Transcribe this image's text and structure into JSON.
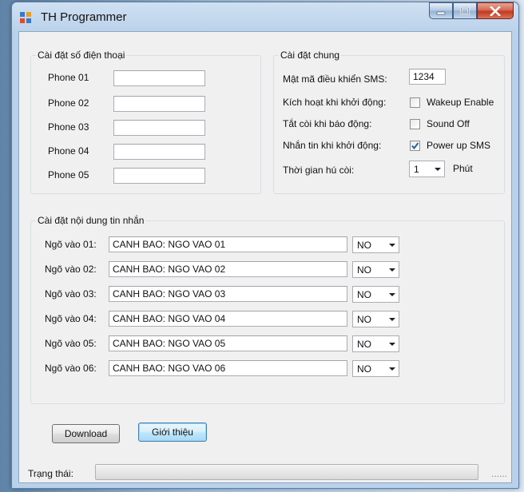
{
  "window": {
    "title": "TH Programmer"
  },
  "phone_group": {
    "title": "Cài đặt số điện thoại",
    "items": [
      {
        "label": "Phone 01",
        "value": ""
      },
      {
        "label": "Phone 02",
        "value": ""
      },
      {
        "label": "Phone 03",
        "value": ""
      },
      {
        "label": "Phone 04",
        "value": ""
      },
      {
        "label": "Phone 05",
        "value": ""
      }
    ]
  },
  "general_group": {
    "title": "Cài đặt chung",
    "sms_password_label": "Mật mã điều khiển SMS:",
    "sms_password_value": "1234",
    "startup_enable_label": "Kích hoạt khi khởi động:",
    "wakeup_enable": {
      "label": "Wakeup Enable",
      "checked": false
    },
    "alarm_mute_label": "Tắt còi khi báo động:",
    "sound_off": {
      "label": "Sound Off",
      "checked": false
    },
    "startup_sms_label": "Nhắn tin khi khởi động:",
    "power_up_sms": {
      "label": "Power up SMS",
      "checked": true
    },
    "siren_time_label": "Thời gian hú còi:",
    "siren_time_value": "1",
    "siren_time_unit": "Phút"
  },
  "message_group": {
    "title": "Cài đặt nội dung tin nhắn",
    "rows": [
      {
        "label": "Ngõ vào 01:",
        "message": "CANH BAO: NGO VAO 01",
        "mode": "NO"
      },
      {
        "label": "Ngõ vào 02:",
        "message": "CANH BAO: NGO VAO 02",
        "mode": "NO"
      },
      {
        "label": "Ngõ vào 03:",
        "message": "CANH BAO: NGO VAO 03",
        "mode": "NO"
      },
      {
        "label": "Ngõ vào 04:",
        "message": "CANH BAO: NGO VAO 04",
        "mode": "NO"
      },
      {
        "label": "Ngõ vào 05:",
        "message": "CANH BAO: NGO VAO 05",
        "mode": "NO"
      },
      {
        "label": "Ngõ vào 06:",
        "message": "CANH BAO: NGO VAO 06",
        "mode": "NO"
      }
    ]
  },
  "buttons": {
    "download": "Download",
    "about": "Giới thiệu"
  },
  "status": {
    "label": "Trạng thái:",
    "progress": 0,
    "text": "......"
  },
  "colors": {
    "checkmark": "#2a5fa8",
    "close_button": "#c2391f"
  }
}
